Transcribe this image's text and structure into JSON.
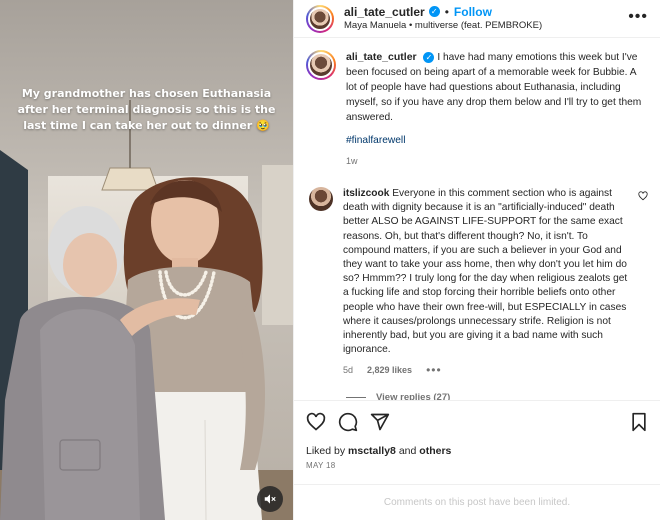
{
  "media": {
    "caption": "My grandmother has chosen Euthanasia after her terminal diagnosis so this is the last time I can take her out to dinner 🥹",
    "mute_icon": "speaker-muted-icon"
  },
  "header": {
    "username": "ali_tate_cutler",
    "verified_icon": "verified-badge-icon",
    "separator": "•",
    "follow_label": "Follow",
    "audio": "Maya Manuela • multiverse (feat. PEMBROKE)",
    "more_icon": "more-horizontal-icon"
  },
  "post": {
    "username": "ali_tate_cutler",
    "text": "I have had many emotions this week but I've been focused on being apart of a memorable week for Bubbie. A lot of people have had questions about Euthanasia, including myself, so if you have any drop them below and I'll try to get them answered.",
    "hashtag": "#finalfarewell",
    "age": "1w"
  },
  "comment": {
    "username": "itslizcook",
    "text": "Everyone in this comment section who is against death with dignity because it is an \"artificially-induced\" death better ALSO be AGAINST LIFE-SUPPORT for the same exact reasons. Oh, but that's different though? No, it isn't. To compound matters, if you are such a believer in your God and they want to take your ass home, then why don't you let him do so? Hmmm?? I truly long for the day when religious zealots get a fucking life and stop forcing their horrible beliefs onto other people who have their own free-will, but ESPECIALLY in cases where it causes/prolongs unnecessary strife. Religion is not inherently bad, but you are giving it a bad name with such ignorance.",
    "age": "5d",
    "likes": "2,829 likes",
    "more": "•••",
    "view_replies": "View replies (27)"
  },
  "actions": {
    "icons": [
      "heart-icon",
      "comment-icon",
      "share-icon",
      "bookmark-icon"
    ],
    "liked_by_prefix": "Liked by",
    "liked_by_user": "msctally8",
    "liked_by_and": "and",
    "liked_by_others": "others",
    "date": "MAY 18"
  },
  "footer": {
    "limited": "Comments on this post have been limited."
  },
  "colors": {
    "accent": "#0095f6",
    "hashtag": "#00376b",
    "muted_text": "#737373"
  }
}
